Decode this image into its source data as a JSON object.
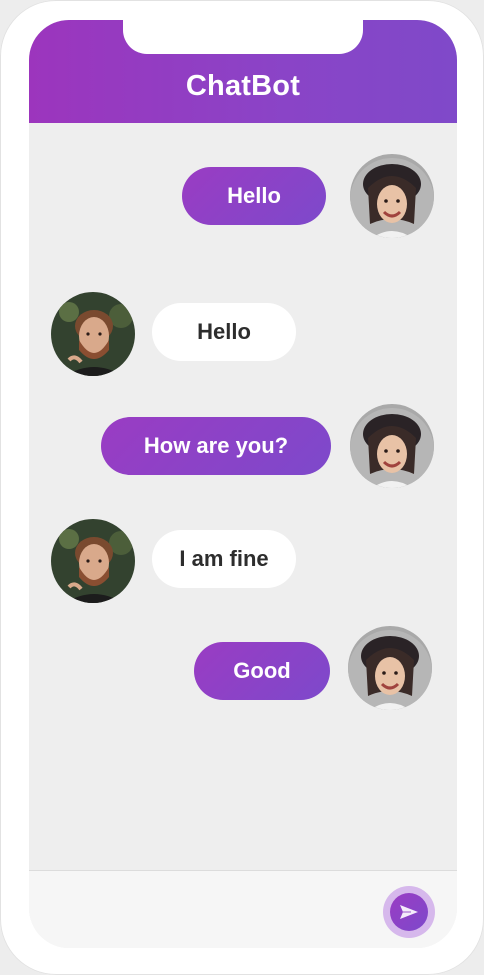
{
  "header": {
    "title": "ChatBot"
  },
  "messages": [
    {
      "side": "sent",
      "text": "Hello",
      "avatar": "woman-avatar"
    },
    {
      "side": "received",
      "text": "Hello",
      "avatar": "man-avatar"
    },
    {
      "side": "sent",
      "text": "How are you?",
      "avatar": "woman-avatar"
    },
    {
      "side": "received",
      "text": "I am fine",
      "avatar": "man-avatar"
    },
    {
      "side": "sent",
      "text": "Good",
      "avatar": "woman-avatar"
    }
  ],
  "composer": {
    "send_icon": "send-icon"
  },
  "colors": {
    "accent": "#8a44c7",
    "accent_light": "#d6b8ec",
    "received_bubble": "#ffffff",
    "screen_bg": "#eeeeee"
  }
}
